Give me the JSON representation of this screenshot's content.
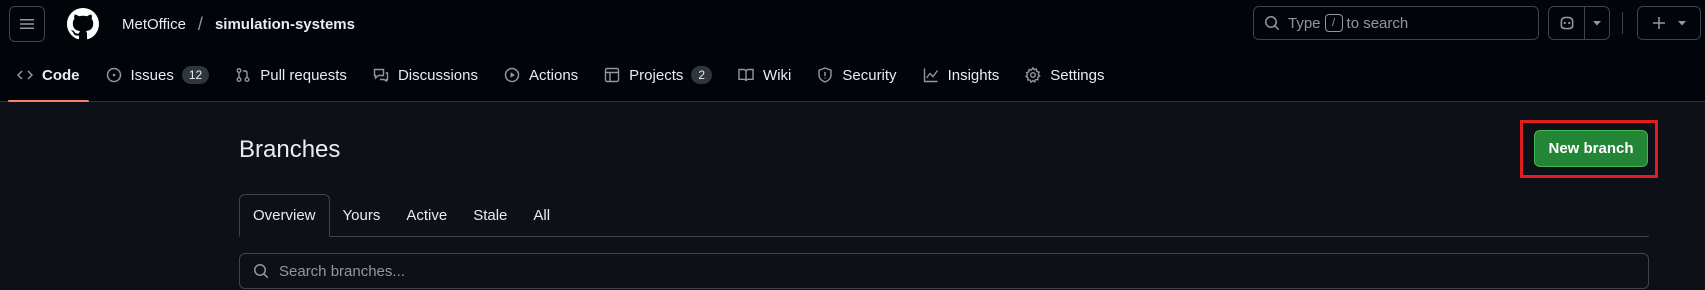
{
  "header": {
    "owner": "MetOffice",
    "separator": "/",
    "repo": "simulation-systems",
    "search": {
      "prefix": "Type",
      "key": "/",
      "suffix": "to search"
    }
  },
  "nav": {
    "tabs": [
      {
        "label": "Code",
        "icon": "code-icon",
        "active": true
      },
      {
        "label": "Issues",
        "icon": "issue-icon",
        "count": "12"
      },
      {
        "label": "Pull requests",
        "icon": "pull-request-icon"
      },
      {
        "label": "Discussions",
        "icon": "discussions-icon"
      },
      {
        "label": "Actions",
        "icon": "play-icon"
      },
      {
        "label": "Projects",
        "icon": "table-icon",
        "count": "2"
      },
      {
        "label": "Wiki",
        "icon": "book-icon"
      },
      {
        "label": "Security",
        "icon": "shield-icon"
      },
      {
        "label": "Insights",
        "icon": "graph-icon"
      },
      {
        "label": "Settings",
        "icon": "gear-icon"
      }
    ]
  },
  "page": {
    "title": "Branches",
    "new_branch_label": "New branch",
    "subtabs": [
      "Overview",
      "Yours",
      "Active",
      "Stale",
      "All"
    ],
    "search_placeholder": "Search branches..."
  },
  "colors": {
    "accent_underline": "#f78166",
    "primary_button": "#238636",
    "highlight_box": "#e01e1e"
  }
}
